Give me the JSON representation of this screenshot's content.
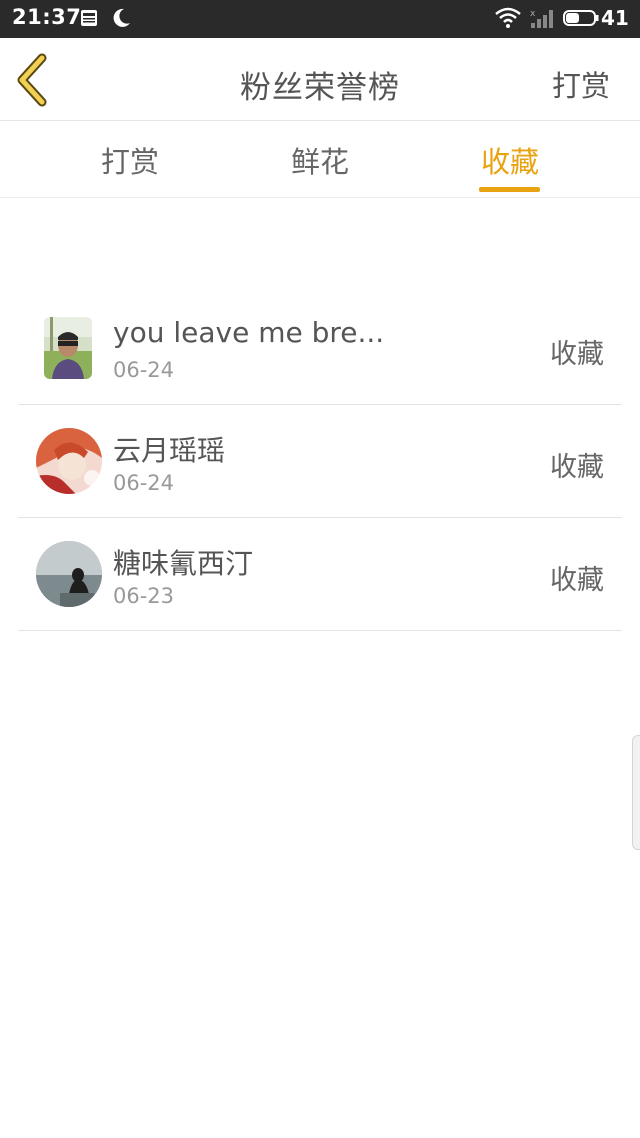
{
  "status_bar": {
    "time": "21:37",
    "battery": "41",
    "icons": [
      "news-icon",
      "moon-icon",
      "wifi-icon",
      "signal-icon",
      "battery-icon"
    ]
  },
  "header": {
    "title": "粉丝荣誉榜",
    "right_action": "打赏",
    "back_icon": "chevron-left-icon"
  },
  "tabs": [
    {
      "label": "打赏",
      "active": false
    },
    {
      "label": "鲜花",
      "active": false
    },
    {
      "label": "收藏",
      "active": true
    }
  ],
  "accent_color": "#e8a312",
  "fans": [
    {
      "name": "you leave me bre...",
      "date": "06-24",
      "type": "收藏"
    },
    {
      "name": "云月瑶瑶",
      "date": "06-24",
      "type": "收藏"
    },
    {
      "name": "糖味氰西汀",
      "date": "06-23",
      "type": "收藏"
    }
  ]
}
